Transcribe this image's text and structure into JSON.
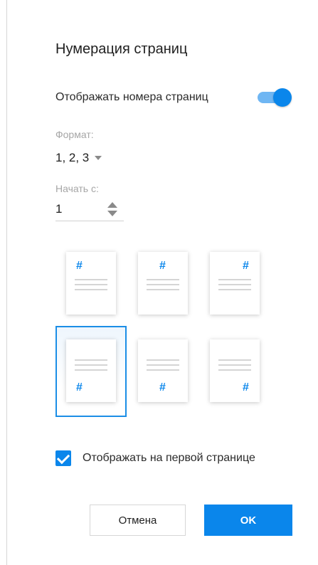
{
  "dialog": {
    "title": "Нумерация страниц",
    "show_numbers_label": "Отображать номера страниц",
    "show_numbers_enabled": true,
    "format": {
      "label": "Формат:",
      "value": "1, 2, 3"
    },
    "start": {
      "label": "Начать с:",
      "value": "1"
    },
    "position_options": [
      {
        "id": "top-left",
        "hash": "#",
        "selected": false
      },
      {
        "id": "top-center",
        "hash": "#",
        "selected": false
      },
      {
        "id": "top-right",
        "hash": "#",
        "selected": false
      },
      {
        "id": "bottom-left",
        "hash": "#",
        "selected": true
      },
      {
        "id": "bottom-center",
        "hash": "#",
        "selected": false
      },
      {
        "id": "bottom-right",
        "hash": "#",
        "selected": false
      }
    ],
    "first_page": {
      "label": "Отображать на первой странице",
      "checked": true
    },
    "buttons": {
      "cancel": "Отмена",
      "ok": "OK"
    }
  },
  "colors": {
    "accent": "#0a86eb",
    "toggle_track": "#6fb6f3",
    "selected_border": "#1b8ee6"
  }
}
